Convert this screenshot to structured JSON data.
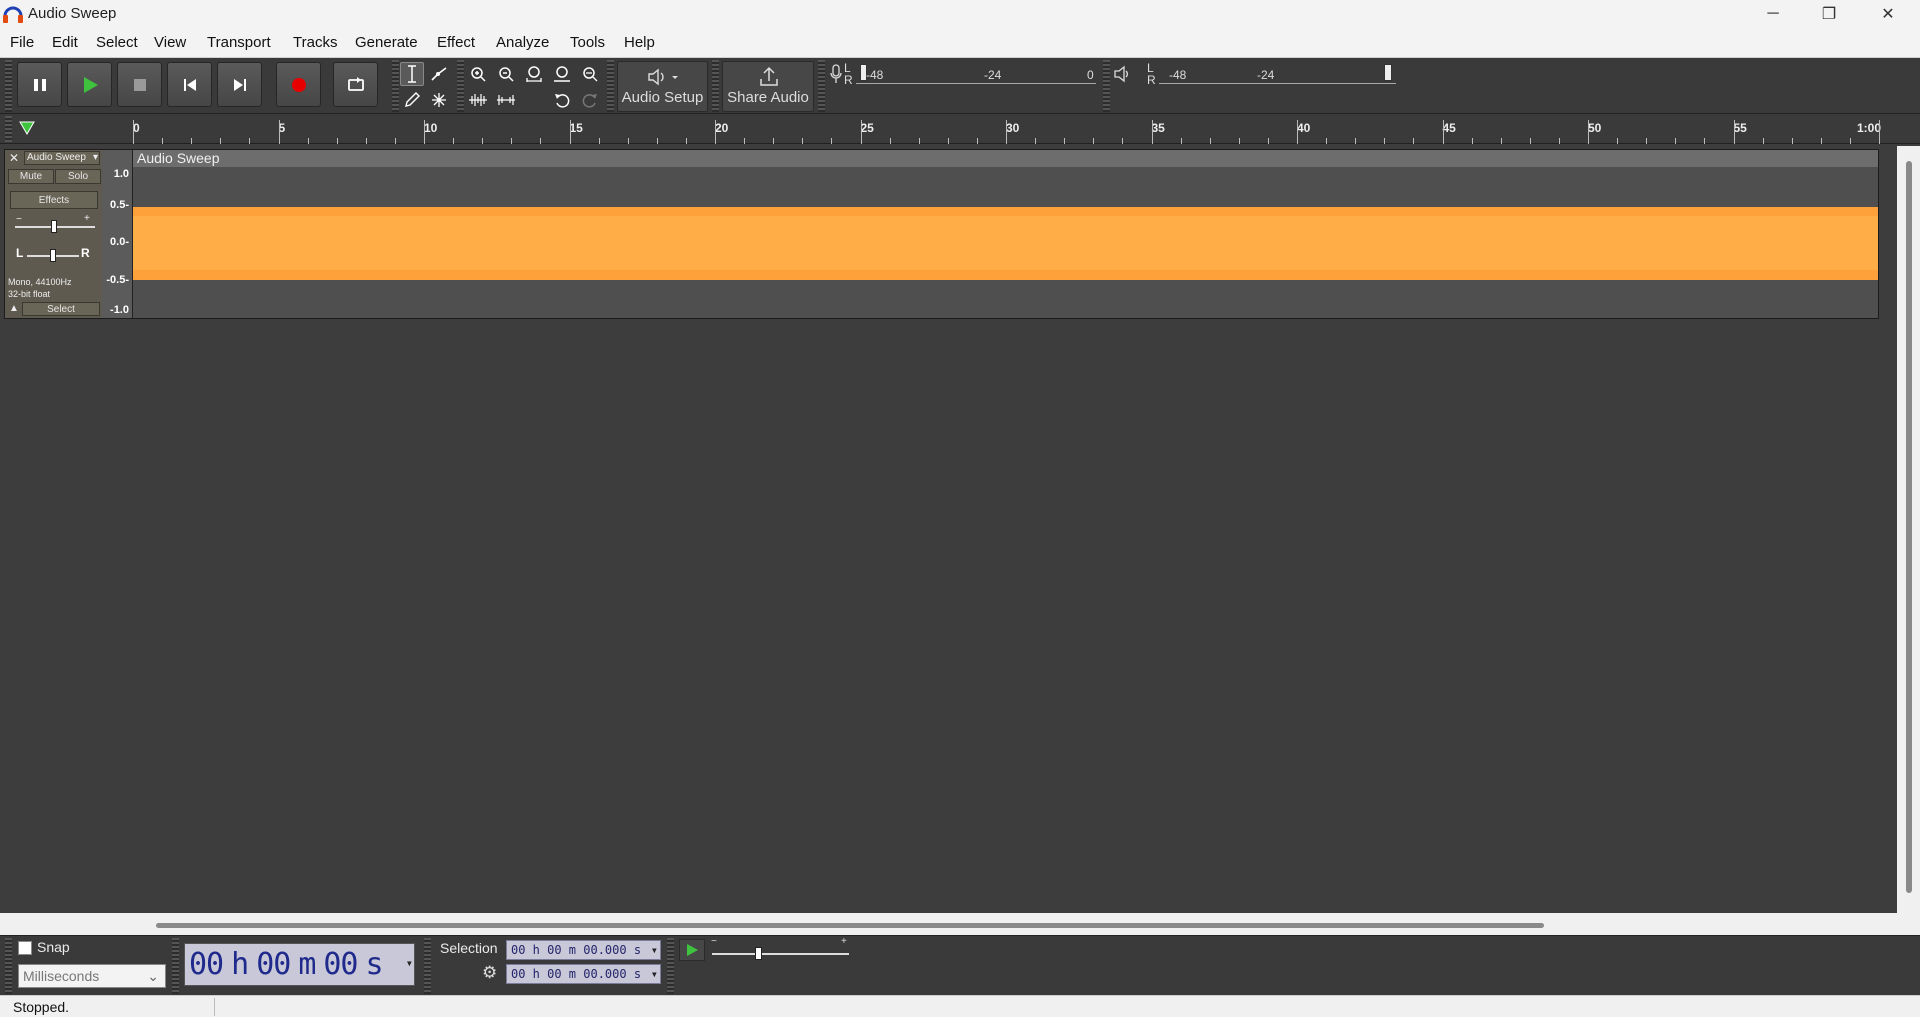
{
  "window": {
    "title": "Audio Sweep",
    "minimize_glyph": "─",
    "maximize_glyph": "❐",
    "close_glyph": "✕"
  },
  "menu": [
    {
      "label": "File"
    },
    {
      "label": "Edit"
    },
    {
      "label": "Select"
    },
    {
      "label": "View"
    },
    {
      "label": "Transport"
    },
    {
      "label": "Tracks"
    },
    {
      "label": "Generate"
    },
    {
      "label": "Effect"
    },
    {
      "label": "Analyze"
    },
    {
      "label": "Tools"
    },
    {
      "label": "Help"
    }
  ],
  "toolbar": {
    "audio_setup_label": "Audio Setup",
    "share_audio_label": "Share Audio",
    "record_meter": {
      "l": "L",
      "r": "R",
      "ticks": [
        "-48",
        "-24",
        "0"
      ]
    },
    "play_meter": {
      "l": "L",
      "r": "R",
      "ticks": [
        "-48",
        "-24"
      ]
    },
    "icons": {
      "pause": "pause-icon",
      "play": "play-icon",
      "stop": "stop-icon",
      "skip_start": "skip-to-start-icon",
      "skip_end": "skip-to-end-icon",
      "record": "record-icon",
      "loop": "loop-icon",
      "select_tool": "i-beam-icon",
      "envelope_tool": "envelope-icon",
      "draw_tool": "pencil-icon",
      "multi_tool": "asterisk-icon",
      "zoom_in": "zoom-in-icon",
      "zoom_out": "zoom-out-icon",
      "fit_selection": "fit-selection-icon",
      "fit_project": "fit-project-icon",
      "zoom_toggle": "zoom-toggle-icon",
      "trim": "trim-icon",
      "silence": "silence-icon",
      "undo": "undo-icon",
      "redo": "redo-icon"
    },
    "colors": {
      "play": "#3fc33f",
      "record": "#e60000"
    }
  },
  "ruler": {
    "labels": [
      "0",
      "5",
      "10",
      "15",
      "20",
      "25",
      "30",
      "35",
      "40",
      "45",
      "50",
      "55",
      "1:00"
    ]
  },
  "track": {
    "name": "Audio Sweep",
    "mute_label": "Mute",
    "solo_label": "Solo",
    "effects_label": "Effects",
    "gain_minus": "−",
    "gain_plus": "+",
    "pan_left": "L",
    "pan_right": "R",
    "format_line1": "Mono, 44100Hz",
    "format_line2": "32-bit float",
    "select_label": "Select",
    "scale_labels": [
      "1.0",
      "0.5-",
      "0.0-",
      "-0.5-",
      "-1.0"
    ],
    "clip_name": "Audio Sweep",
    "wave_color": "#ffa13a"
  },
  "selection_toolbar": {
    "snap_label": "Snap",
    "snap_checked": false,
    "snap_unit": "Milliseconds",
    "time_parts": [
      "00",
      "h",
      "00",
      "m",
      "00",
      "s"
    ],
    "selection_label": "Selection",
    "selection_start": "00 h 00 m 00.000 s",
    "selection_end": "00 h 00 m 00.000 s",
    "play_at_speed_minus": "−",
    "play_at_speed_plus": "+"
  },
  "status": {
    "text": "Stopped."
  }
}
